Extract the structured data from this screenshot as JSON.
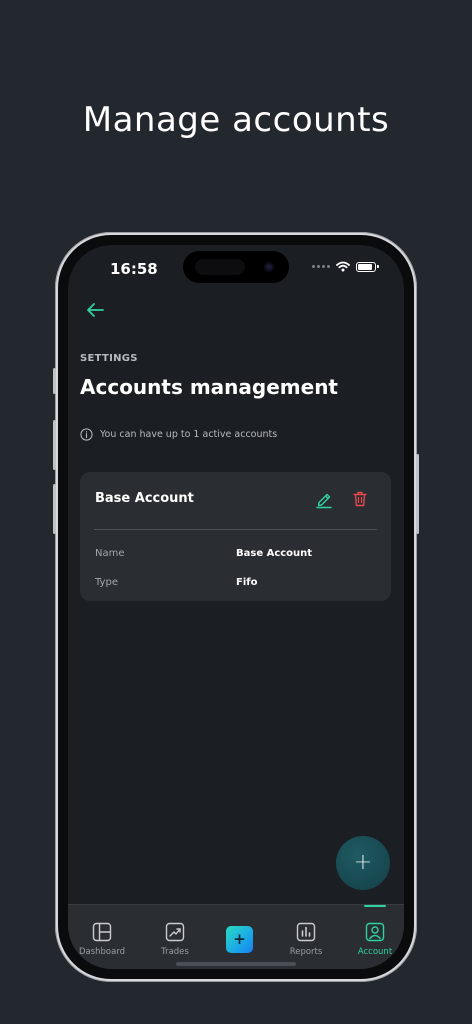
{
  "hero": {
    "title": "Manage accounts"
  },
  "status_bar": {
    "time": "16:58"
  },
  "header": {
    "section_label": "SETTINGS",
    "title": "Accounts management",
    "info_text": "You can have up to 1 active accounts"
  },
  "account_card": {
    "title": "Base Account",
    "fields": [
      {
        "label": "Name",
        "value": "Base Account"
      },
      {
        "label": "Type",
        "value": "Fifo"
      }
    ]
  },
  "fab": {
    "label": "+"
  },
  "tab_bar": {
    "center_label": "+",
    "active_tab": "Account",
    "tabs": [
      {
        "label": "Dashboard",
        "icon": "dashboard-icon"
      },
      {
        "label": "Trades",
        "icon": "trades-icon"
      },
      {
        "label": "Reports",
        "icon": "reports-icon"
      },
      {
        "label": "Account",
        "icon": "account-icon"
      }
    ]
  },
  "colors": {
    "accent": "#2ed3a0",
    "danger": "#e5484d",
    "background": "#23272e",
    "screen": "#1b1e22",
    "card": "#2a2d32"
  }
}
